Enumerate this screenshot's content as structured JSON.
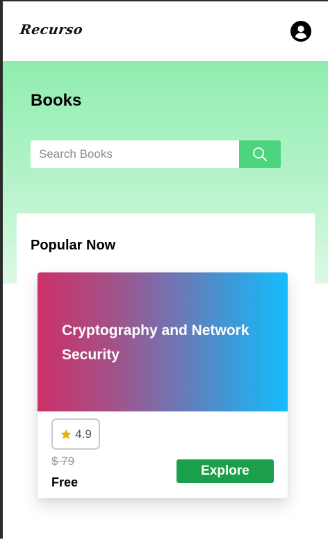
{
  "navbar": {
    "logo": "Recurso",
    "avatar_icon": "user-circle-icon"
  },
  "hero": {
    "title": "Books",
    "search": {
      "placeholder": "Search Books",
      "value": "",
      "button_icon": "search-icon"
    }
  },
  "popular": {
    "title": "Popular Now",
    "books": [
      {
        "title": "Cryptography and Network Security",
        "rating": "4.9",
        "rating_icon": "star-icon",
        "old_price": "$ 79",
        "price": "Free",
        "action_label": "Explore"
      }
    ]
  },
  "colors": {
    "hero_top": "#8fedaf",
    "hero_bottom": "#dcf9e5",
    "search_button": "#4cd47f",
    "explore_button": "#1c9f4a",
    "cover_start": "#cb3168",
    "cover_end": "#14bdfe",
    "star": "#e8b10f"
  }
}
